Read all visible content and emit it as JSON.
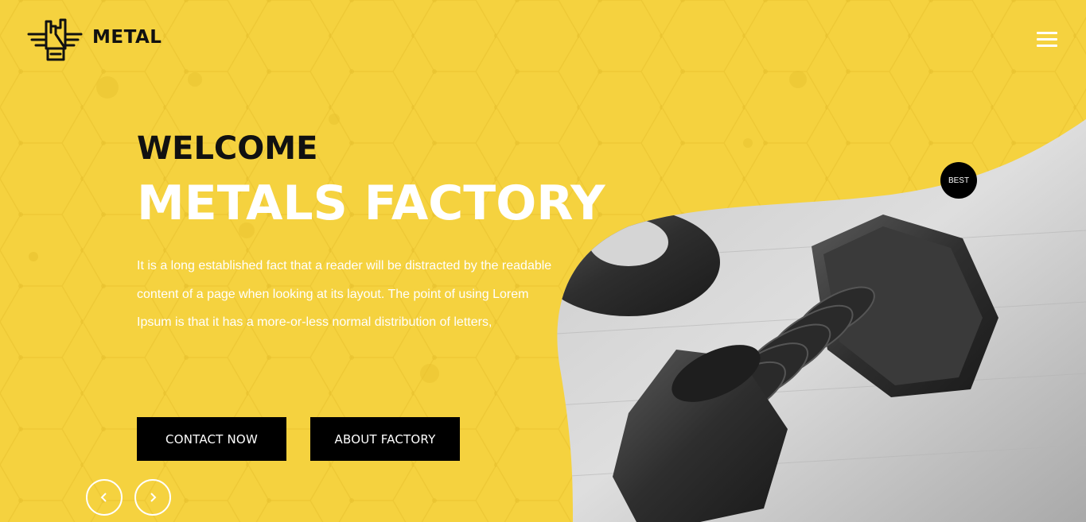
{
  "brand": {
    "name": "METAL"
  },
  "hero": {
    "welcome": "WELCOME",
    "title": "METALS FACTORY",
    "description": "It is a long established fact that a reader will be distracted by the readable content of a page when looking at its layout. The point of using Lorem Ipsum is that it has a more-or-less normal distribution of letters,",
    "badge": "BEST"
  },
  "buttons": {
    "contact": "CONTACT NOW",
    "about": "ABOUT FACTORY"
  },
  "icons": {
    "logo": "rock-hand-wings-logo-icon",
    "menu": "hamburger-menu-icon",
    "prev": "chevron-left-icon",
    "next": "chevron-right-icon"
  },
  "colors": {
    "brand_yellow": "#f5d23f",
    "button_bg": "#000000",
    "text_dark": "#111111",
    "text_light": "#ffffff"
  }
}
